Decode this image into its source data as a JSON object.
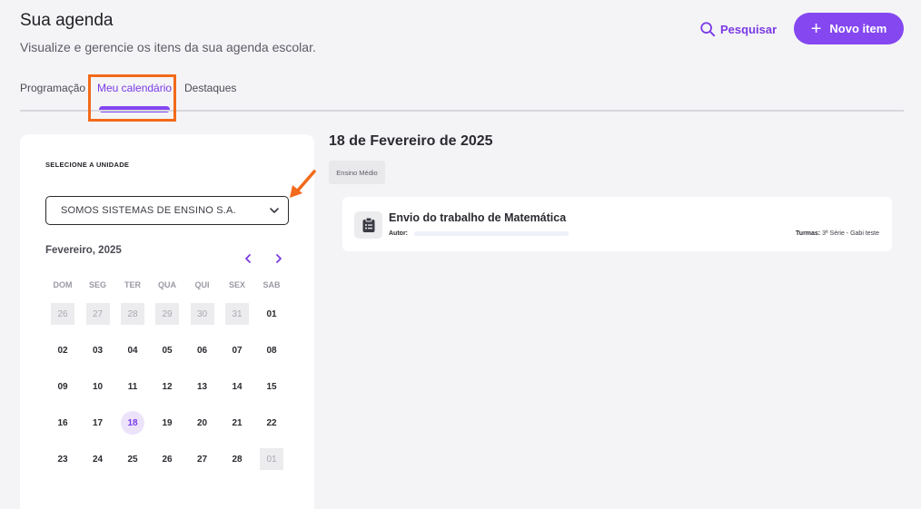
{
  "header": {
    "title": "Sua agenda",
    "subtitle": "Visualize e gerencie os itens da sua agenda escolar.",
    "search_label": "Pesquisar",
    "new_item_label": "Novo item"
  },
  "tabs": [
    {
      "label": "Programação",
      "active": false
    },
    {
      "label": "Meu calendário",
      "active": true
    },
    {
      "label": "Destaques",
      "active": false
    }
  ],
  "calendar": {
    "unit_label": "SELECIONE A UNIDADE",
    "unit_selected": "SOMOS SISTEMAS DE ENSINO S.A.",
    "month_label": "Fevereiro, 2025",
    "weekdays": [
      "DOM",
      "SEG",
      "TER",
      "QUA",
      "QUI",
      "SEX",
      "SAB"
    ],
    "weeks": [
      [
        "26",
        "27",
        "28",
        "29",
        "30",
        "31",
        "01"
      ],
      [
        "02",
        "03",
        "04",
        "05",
        "06",
        "07",
        "08"
      ],
      [
        "09",
        "10",
        "11",
        "12",
        "13",
        "14",
        "15"
      ],
      [
        "16",
        "17",
        "18",
        "19",
        "20",
        "21",
        "22"
      ],
      [
        "23",
        "24",
        "25",
        "26",
        "27",
        "28",
        "01"
      ]
    ],
    "selected_day": "18"
  },
  "detail": {
    "date_title": "18 de Fevereiro de 2025",
    "level_tag": "Ensino Médio",
    "event": {
      "title": "Envio do trabalho de Matemática",
      "author_label": "Autor:",
      "classes_label": "Turmas:",
      "classes_value": "3ª Série - Gabi teste",
      "icon": "clipboard-icon"
    }
  },
  "colors": {
    "accent": "#8447f0",
    "annotation": "#f26a1b"
  }
}
